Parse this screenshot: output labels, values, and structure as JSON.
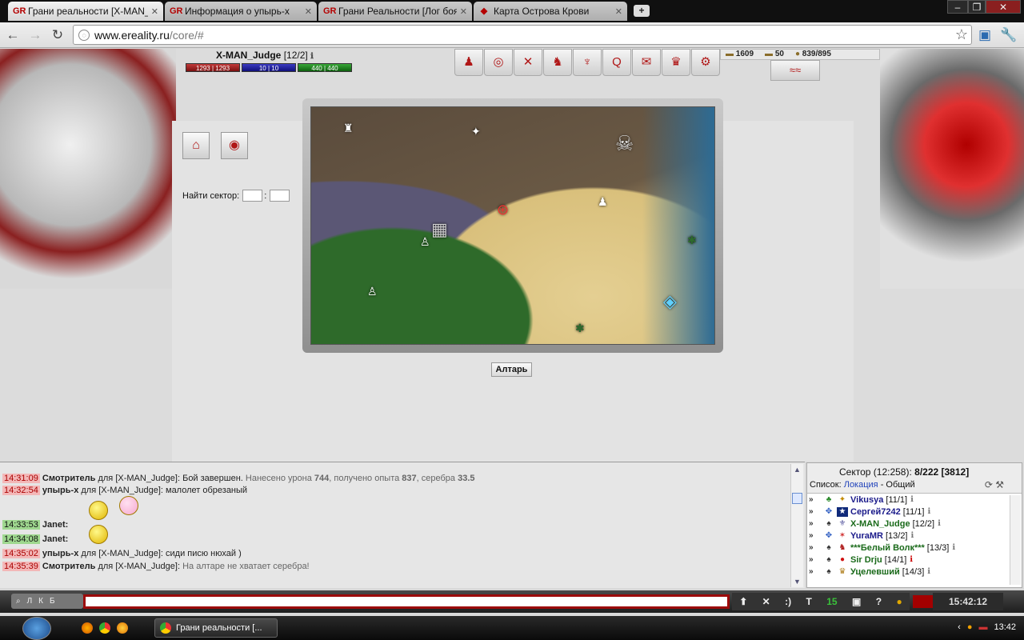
{
  "browser": {
    "tabs": [
      {
        "title": "Грани реальности [X-MAN_Ju..."
      },
      {
        "title": "Информация о упырь-х"
      },
      {
        "title": "Грани Реальности [Лог боя]"
      },
      {
        "title": "Карта Острова Крови"
      }
    ],
    "url_host": "www.ereality.ru",
    "url_path": "/core/#"
  },
  "character": {
    "name": "X-MAN_Judge",
    "level": "[12/2]",
    "hp": "1293 | 1293",
    "mp": "10 | 10",
    "xp": "440 | 440"
  },
  "resources": {
    "silver": "1609",
    "gold": "50",
    "weight": "839/895"
  },
  "find_sector": {
    "label": "Найти сектор:"
  },
  "map": {
    "action_button": "Алтарь"
  },
  "chat": {
    "lines": [
      {
        "time": "14:31:09",
        "time_style": "red",
        "nick": "Смотритель",
        "to": "для [X-MAN_Judge]:",
        "text": "Бой завершен."
      },
      {
        "time": "14:32:54",
        "time_style": "red",
        "nick": "упырь-х",
        "to": "для [X-MAN_Judge]:",
        "text": "малолет обрезаный"
      },
      {
        "time": "14:33:53",
        "time_style": "green",
        "nick": "Janet",
        "to": "",
        "text": ""
      },
      {
        "time": "14:34:08",
        "time_style": "green",
        "nick": "Janet",
        "to": "",
        "text": ""
      },
      {
        "time": "14:35:02",
        "time_style": "red",
        "nick": "упырь-х",
        "to": "для [X-MAN_Judge]:",
        "text": "сиди писю нюхай )"
      },
      {
        "time": "14:35:39",
        "time_style": "red",
        "nick": "Смотритель",
        "to": "для [X-MAN_Judge]:",
        "text": "На алтаре не хватает серебра!"
      }
    ],
    "battle_detail": {
      "prefix": "Нанесено урона",
      "damage": "744",
      "mid1": ", получено опыта",
      "exp": "837",
      "mid2": ", серебра",
      "silver": "33.5"
    }
  },
  "online": {
    "sector_label": "Сектор (12:258):",
    "sector_count": "8/222",
    "sector_total": "[3812]",
    "list_label": "Список:",
    "list_location": "Локация",
    "list_sep": " - ",
    "list_general": "Общий",
    "players": [
      {
        "name": "Vikusya",
        "level": "[11/1]",
        "color": "#1a1a8a"
      },
      {
        "name": "Сергей7242",
        "level": "[11/1]",
        "color": "#1a1a8a"
      },
      {
        "name": "X-MAN_Judge",
        "level": "[12/2]",
        "color": "#1a6a1a"
      },
      {
        "name": "YuraMR",
        "level": "[13/2]",
        "color": "#1a1a8a"
      },
      {
        "name": "***Белый Волк***",
        "level": "[13/3]",
        "color": "#1a6a1a"
      },
      {
        "name": "Sir Drju",
        "level": "[14/1]",
        "color": "#1a6a1a"
      },
      {
        "name": "Уцелевший",
        "level": "[14/3]",
        "color": "#1a6a1a"
      }
    ]
  },
  "bottombar": {
    "count": "15",
    "clock": "15:42:12"
  },
  "taskbar": {
    "task_title": "Грани реальности [...",
    "time": "13:42"
  }
}
